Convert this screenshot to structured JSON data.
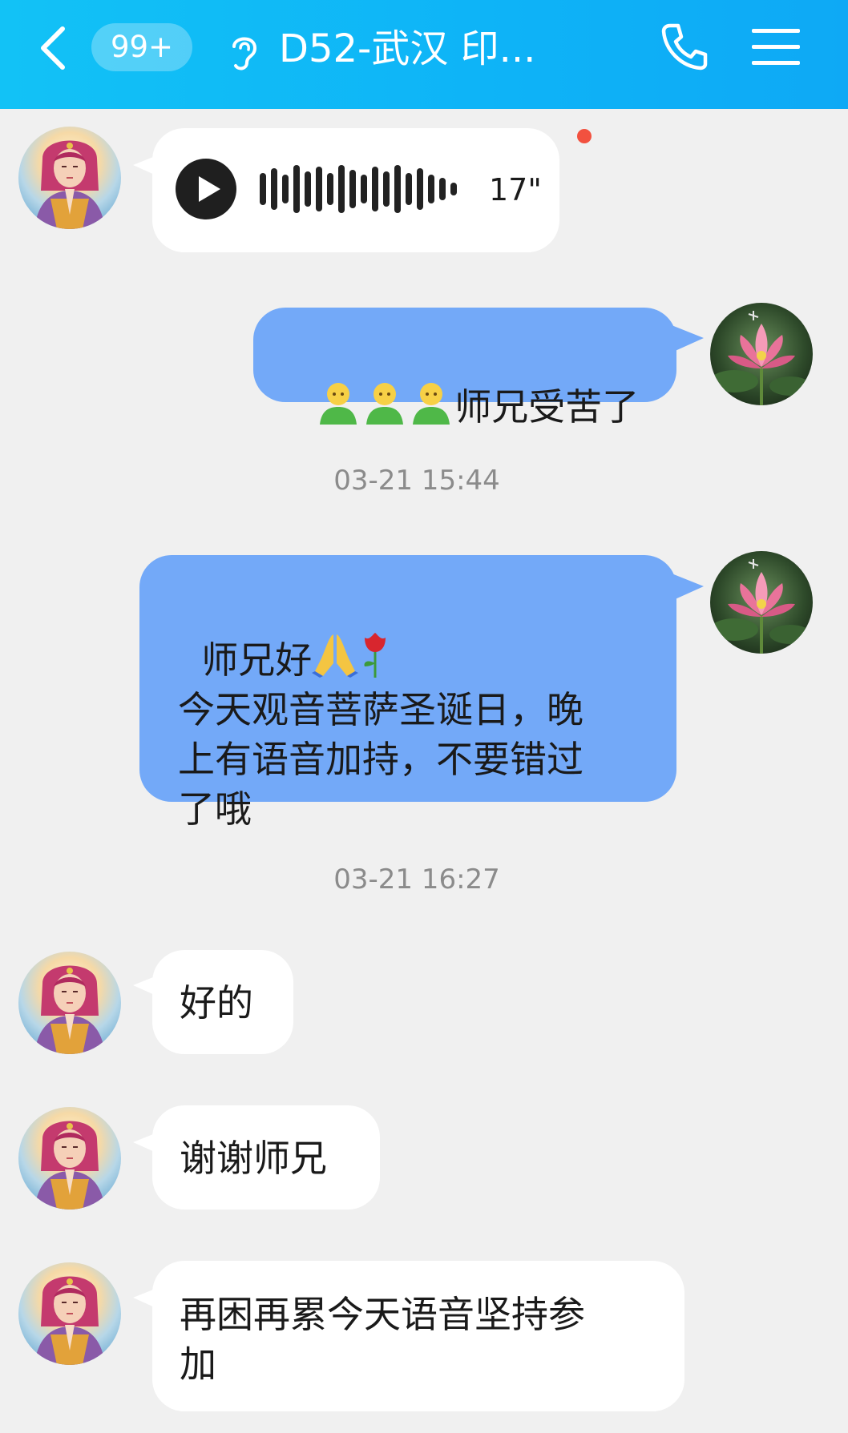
{
  "header": {
    "unread_badge": "99+",
    "title": "D52-武汉 印...",
    "back_icon": "chevron-left-icon",
    "voice_mode_icon": "ear-icon",
    "call_icon": "phone-icon",
    "menu_icon": "hamburger-menu-icon",
    "background_color": "#12c2f6"
  },
  "colors": {
    "incoming_bubble": "#ffffff",
    "outgoing_bubble": "#73a9f8",
    "unread_dot": "#f2513f",
    "chat_background": "#f0f0f0"
  },
  "messages": {
    "voice": {
      "duration": "17\"",
      "unread": true
    },
    "m2": {
      "text": "师兄受苦了"
    },
    "ts1": "03-21 15:44",
    "m3": {
      "line1": "师兄好",
      "text": "今天观音菩萨圣诞日，晚\n上有语音加持，不要错过\n了哦"
    },
    "ts2": "03-21 16:27",
    "m4": {
      "text": "好的"
    },
    "m5": {
      "text": "谢谢师兄"
    },
    "m6": {
      "text": "再困再累今天语音坚持参\n加"
    }
  }
}
